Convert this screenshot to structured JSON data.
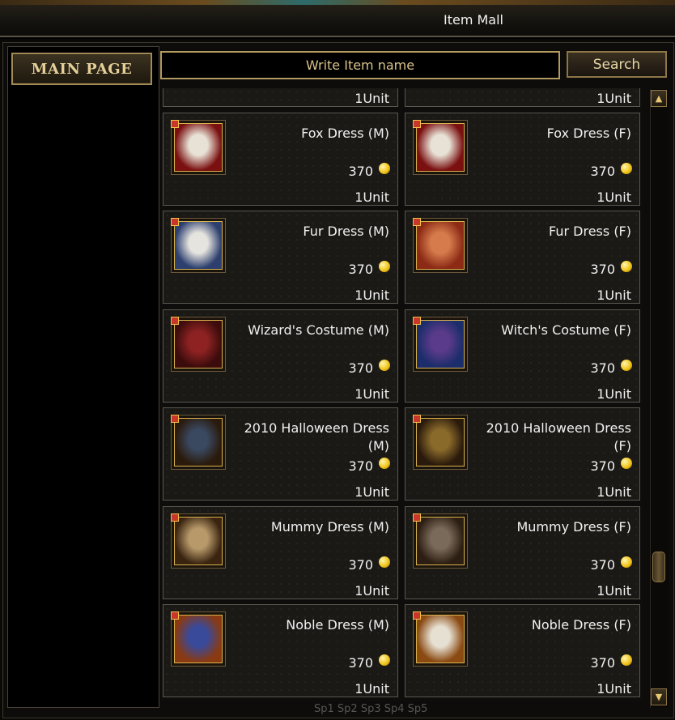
{
  "window": {
    "title": "Item Mall"
  },
  "sidebar": {
    "main_page_label": "MAIN PAGE"
  },
  "search": {
    "placeholder": "Write Item name",
    "button_label": "Search"
  },
  "items": [
    {
      "name": "",
      "price": "",
      "unit": "1Unit",
      "colors": [
        "#3a2a18",
        "#8a6a3a"
      ]
    },
    {
      "name": "",
      "price": "",
      "unit": "1Unit",
      "colors": [
        "#3a2a18",
        "#8a6a3a"
      ]
    },
    {
      "name": "Fox Dress (M)",
      "price": "370",
      "unit": "1Unit",
      "colors": [
        "#7a1010",
        "#e8e2d6"
      ]
    },
    {
      "name": "Fox Dress (F)",
      "price": "370",
      "unit": "1Unit",
      "colors": [
        "#7a1010",
        "#e8e2d6"
      ]
    },
    {
      "name": "Fur Dress (M)",
      "price": "370",
      "unit": "1Unit",
      "colors": [
        "#2c3f6e",
        "#e6e4df"
      ]
    },
    {
      "name": "Fur Dress (F)",
      "price": "370",
      "unit": "1Unit",
      "colors": [
        "#8c2a15",
        "#d67c4c"
      ]
    },
    {
      "name": "Wizard's Costume (M)",
      "price": "370",
      "unit": "1Unit",
      "colors": [
        "#3c0c0c",
        "#8e2222"
      ]
    },
    {
      "name": "Witch's Costume (F)",
      "price": "370",
      "unit": "1Unit",
      "colors": [
        "#1b2d6a",
        "#5a3a8a"
      ]
    },
    {
      "name": "2010 Halloween Dress (M)",
      "price": "370",
      "unit": "1Unit",
      "colors": [
        "#2a1a0c",
        "#3a4860"
      ]
    },
    {
      "name": "2010 Halloween Dress (F)",
      "price": "370",
      "unit": "1Unit",
      "colors": [
        "#2a1a0c",
        "#8a6a2a"
      ]
    },
    {
      "name": "Mummy Dress (M)",
      "price": "370",
      "unit": "1Unit",
      "colors": [
        "#3a2410",
        "#b89a6a"
      ]
    },
    {
      "name": "Mummy Dress (F)",
      "price": "370",
      "unit": "1Unit",
      "colors": [
        "#2c1e12",
        "#7a6a5a"
      ]
    },
    {
      "name": "Noble Dress (M)",
      "price": "370",
      "unit": "1Unit",
      "colors": [
        "#8a3a12",
        "#3a4a9a"
      ]
    },
    {
      "name": "Noble Dress (F)",
      "price": "370",
      "unit": "1Unit",
      "colors": [
        "#8a4a12",
        "#e6e0d2"
      ]
    }
  ],
  "scrollbar": {
    "up_icon": "▲",
    "down_icon": "▼",
    "position_fraction": 0.78
  },
  "footer_ghost": "Sp1 Sp2 Sp3 Sp4 Sp5"
}
